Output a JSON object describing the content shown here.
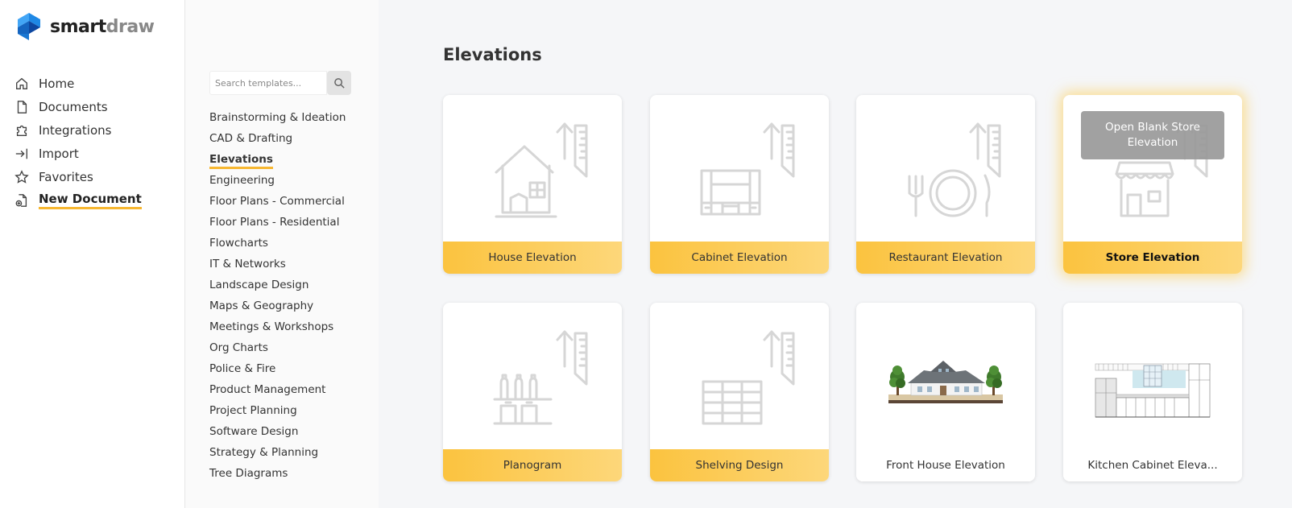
{
  "logo": {
    "part1": "smart",
    "part2": "draw"
  },
  "nav": {
    "items": [
      {
        "label": "Home",
        "icon": "home-icon"
      },
      {
        "label": "Documents",
        "icon": "document-icon"
      },
      {
        "label": "Integrations",
        "icon": "puzzle-icon"
      },
      {
        "label": "Import",
        "icon": "import-icon"
      },
      {
        "label": "Favorites",
        "icon": "star-icon"
      },
      {
        "label": "New Document",
        "icon": "new-document-icon"
      }
    ]
  },
  "search": {
    "placeholder": "Search templates..."
  },
  "categories": [
    "Brainstorming & Ideation",
    "CAD & Drafting",
    "Elevations",
    "Engineering",
    "Floor Plans - Commercial",
    "Floor Plans - Residential",
    "Flowcharts",
    "IT & Networks",
    "Landscape Design",
    "Maps & Geography",
    "Meetings & Workshops",
    "Org Charts",
    "Police & Fire",
    "Product Management",
    "Project Planning",
    "Software Design",
    "Strategy & Planning",
    "Tree Diagrams"
  ],
  "main": {
    "title": "Elevations",
    "cards": [
      {
        "label": "House Elevation"
      },
      {
        "label": "Cabinet Elevation"
      },
      {
        "label": "Restaurant Elevation"
      },
      {
        "label": "Store Elevation",
        "overlay": "Open Blank Store Elevation"
      },
      {
        "label": "Planogram"
      },
      {
        "label": "Shelving Design"
      },
      {
        "label": "Front House Elevation"
      },
      {
        "label": "Kitchen Cabinet Eleva..."
      }
    ]
  },
  "colors": {
    "accent": "#f7b731",
    "card_label_yellow": "#fbc33f"
  }
}
